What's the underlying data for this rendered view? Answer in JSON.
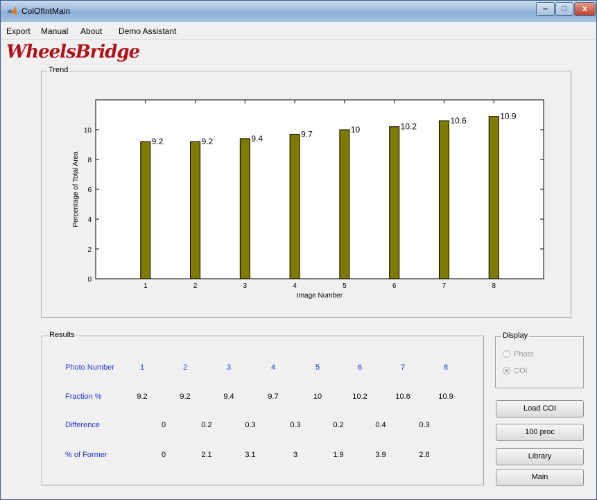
{
  "window": {
    "title": "ColOfIntMain",
    "minimize": "–",
    "maximize": "□",
    "close": "x"
  },
  "menu": {
    "export": "Export",
    "manual": "Manual",
    "about": "About",
    "demo": "Demo Assistant"
  },
  "logo": {
    "text_part1": "Wheels",
    "text_part2": "Bridge"
  },
  "trend": {
    "title": "Trend"
  },
  "chart_data": {
    "type": "bar",
    "categories": [
      "1",
      "2",
      "3",
      "4",
      "5",
      "6",
      "7",
      "8"
    ],
    "values": [
      9.2,
      9.2,
      9.4,
      9.7,
      10,
      10.2,
      10.6,
      10.9
    ],
    "data_labels": [
      "9.2",
      "9.2",
      "9.4",
      "9.7",
      "10",
      "10.2",
      "10.6",
      "10.9"
    ],
    "xlabel": "Image Number",
    "ylabel": "Percentage of Total Area",
    "ylim": [
      0,
      12
    ],
    "xlim": [
      0,
      9
    ],
    "yticks": [
      "0",
      "2",
      "4",
      "6",
      "8",
      "10"
    ],
    "bar_color": "#7f7a00",
    "grid": false,
    "legend": "none"
  },
  "results": {
    "title": "Results",
    "labels": {
      "photo_number": "Photo Number",
      "fraction": "Fraction %",
      "difference": "Difference",
      "of_former": "% of Former"
    },
    "photo_numbers": [
      "1",
      "2",
      "3",
      "4",
      "5",
      "6",
      "7",
      "8"
    ],
    "fractions": [
      "9.2",
      "9.2",
      "9.4",
      "9.7",
      "10",
      "10.2",
      "10.6",
      "10.9"
    ],
    "differences": [
      "0",
      "0.2",
      "0.3",
      "0.3",
      "0.2",
      "0.4",
      "0.3"
    ],
    "of_former": [
      "0",
      "2.1",
      "3.1",
      "3",
      "1.9",
      "3.9",
      "2.8"
    ]
  },
  "display": {
    "title": "Display",
    "photo": "Photo",
    "coi": "COI"
  },
  "buttons": {
    "load_coi": "Load COI",
    "proc100": "100 proc",
    "library": "Library",
    "main": "Main"
  }
}
